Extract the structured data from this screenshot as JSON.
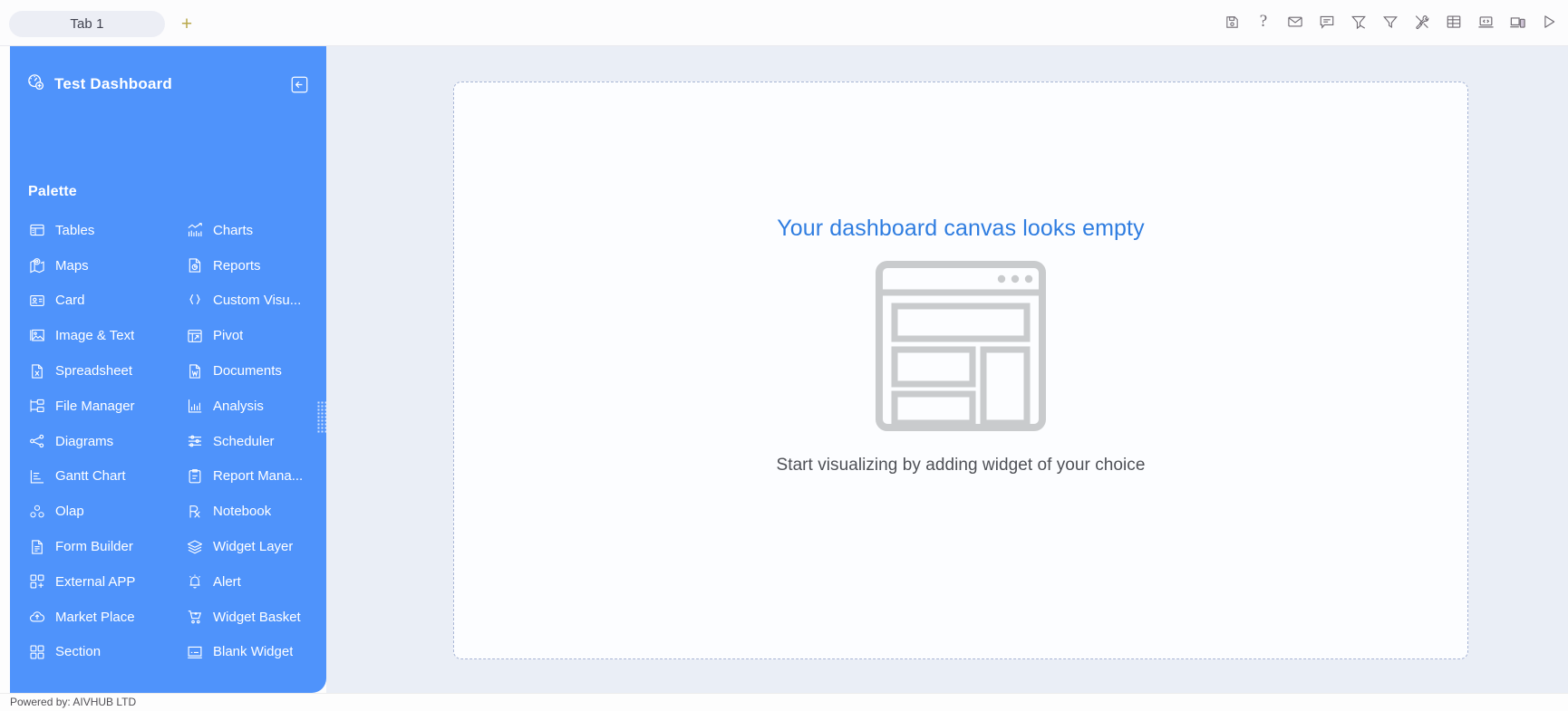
{
  "topbar": {
    "tabs": [
      {
        "label": "Tab 1",
        "active": true
      }
    ],
    "add_tab_label": "+",
    "toolbar_icons": [
      {
        "name": "save-icon",
        "title": "Save"
      },
      {
        "name": "help-icon",
        "title": "Help"
      },
      {
        "name": "mail-icon",
        "title": "Mail"
      },
      {
        "name": "comment-icon",
        "title": "Comment"
      },
      {
        "name": "clear-filter-icon",
        "title": "Clear Filter"
      },
      {
        "name": "filter-icon",
        "title": "Filter"
      },
      {
        "name": "tools-icon",
        "title": "Tools"
      },
      {
        "name": "grid-table-icon",
        "title": "Table"
      },
      {
        "name": "code-laptop-icon",
        "title": "Code"
      },
      {
        "name": "device-preview-icon",
        "title": "Responsive Preview"
      },
      {
        "name": "play-icon",
        "title": "Run"
      }
    ]
  },
  "sidebar": {
    "title": "Test Dashboard",
    "title_icon": "dashboard-add-icon",
    "collapse_icon": "collapse-left-icon",
    "palette_label": "Palette",
    "palette_items": [
      {
        "label": "Tables",
        "icon": "tables-icon"
      },
      {
        "label": "Charts",
        "icon": "charts-icon"
      },
      {
        "label": "Maps",
        "icon": "maps-icon"
      },
      {
        "label": "Reports",
        "icon": "reports-icon"
      },
      {
        "label": "Card",
        "icon": "card-icon"
      },
      {
        "label": "Custom Visu...",
        "icon": "custom-visual-icon"
      },
      {
        "label": "Image & Text",
        "icon": "image-text-icon"
      },
      {
        "label": "Pivot",
        "icon": "pivot-icon"
      },
      {
        "label": "Spreadsheet",
        "icon": "spreadsheet-icon"
      },
      {
        "label": "Documents",
        "icon": "documents-icon"
      },
      {
        "label": "File Manager",
        "icon": "file-manager-icon"
      },
      {
        "label": "Analysis",
        "icon": "analysis-icon"
      },
      {
        "label": "Diagrams",
        "icon": "diagrams-icon"
      },
      {
        "label": "Scheduler",
        "icon": "scheduler-icon"
      },
      {
        "label": "Gantt Chart",
        "icon": "gantt-chart-icon"
      },
      {
        "label": "Report Mana...",
        "icon": "report-manager-icon"
      },
      {
        "label": "Olap",
        "icon": "olap-icon"
      },
      {
        "label": "Notebook",
        "icon": "notebook-icon"
      },
      {
        "label": "Form Builder",
        "icon": "form-builder-icon"
      },
      {
        "label": "Widget Layer",
        "icon": "widget-layer-icon"
      },
      {
        "label": "External APP",
        "icon": "external-app-icon"
      },
      {
        "label": "Alert",
        "icon": "alert-icon"
      },
      {
        "label": "Market Place",
        "icon": "market-place-icon"
      },
      {
        "label": "Widget Basket",
        "icon": "widget-basket-icon"
      },
      {
        "label": "Section",
        "icon": "section-icon"
      },
      {
        "label": "Blank Widget",
        "icon": "blank-widget-icon"
      }
    ]
  },
  "canvas": {
    "empty_title": "Your dashboard canvas looks empty",
    "empty_subtitle": "Start visualizing by adding widget of your choice",
    "illustration": "empty-dashboard-illustration"
  },
  "footer": {
    "text": "Powered by: AIVHUB LTD"
  },
  "colors": {
    "sidebar_blue": "#4f93fb",
    "workspace_bg": "#eaeef6",
    "canvas_bg": "#fcfdff",
    "canvas_border": "#a9b6d6",
    "empty_title_blue": "#2f7de0",
    "tab_bg": "#eceef5",
    "add_tab": "#b9a84c",
    "illustration_gray": "#c9cbcd"
  }
}
